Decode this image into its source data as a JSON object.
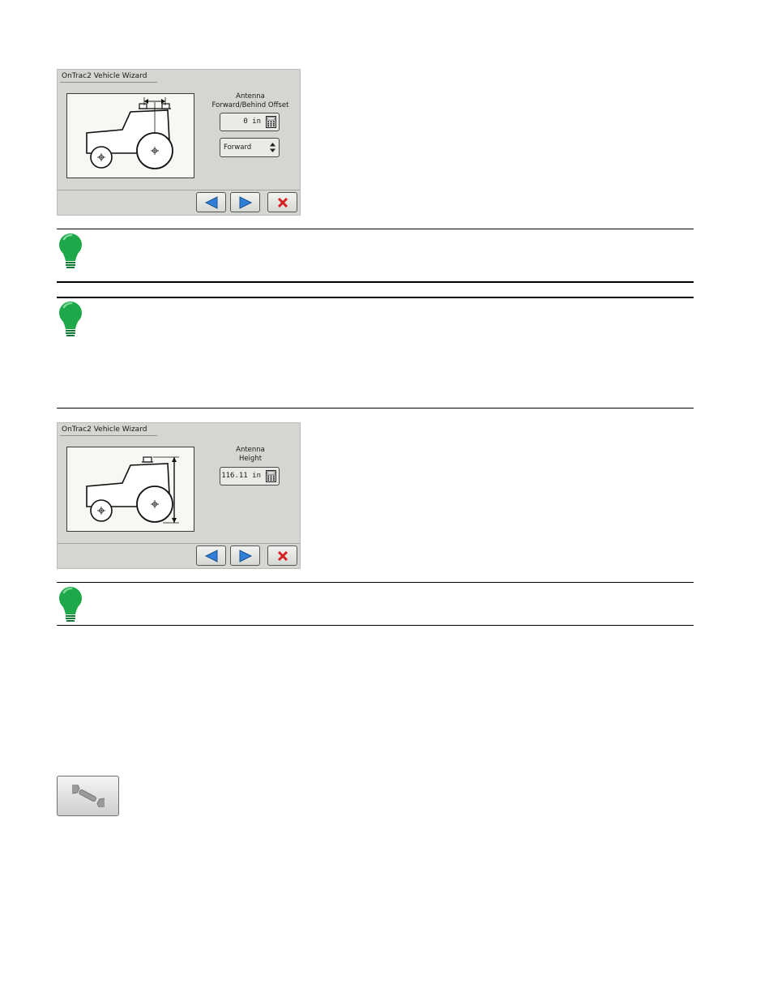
{
  "wizard1": {
    "title": "OnTrac2 Vehicle Wizard",
    "field_label_line1": "Antenna",
    "field_label_line2": "Forward/Behind Offset",
    "value": "0 in",
    "direction_selected": "Forward",
    "icons": [
      "calculator-icon",
      "up-down-arrows-icon",
      "back-arrow-icon",
      "next-arrow-icon",
      "cancel-x-icon"
    ]
  },
  "wizard2": {
    "title": "OnTrac2 Vehicle Wizard",
    "field_label_line1": "Antenna",
    "field_label_line2": "Height",
    "value": "116.11 in",
    "icons": [
      "calculator-icon",
      "back-arrow-icon",
      "next-arrow-icon",
      "cancel-x-icon"
    ]
  },
  "notes": {
    "icon": "lightbulb-icon",
    "colors": {
      "bulb": "#1fa84a",
      "bulb_dark": "#0d7a33"
    }
  },
  "tool_button": {
    "icon": "wrench-icon"
  },
  "colors": {
    "panel_bg": "#d3d6d1",
    "diagram_bg": "#f6f8f3",
    "arrow_blue": "#2f7fd8",
    "cancel_red": "#d62020"
  }
}
